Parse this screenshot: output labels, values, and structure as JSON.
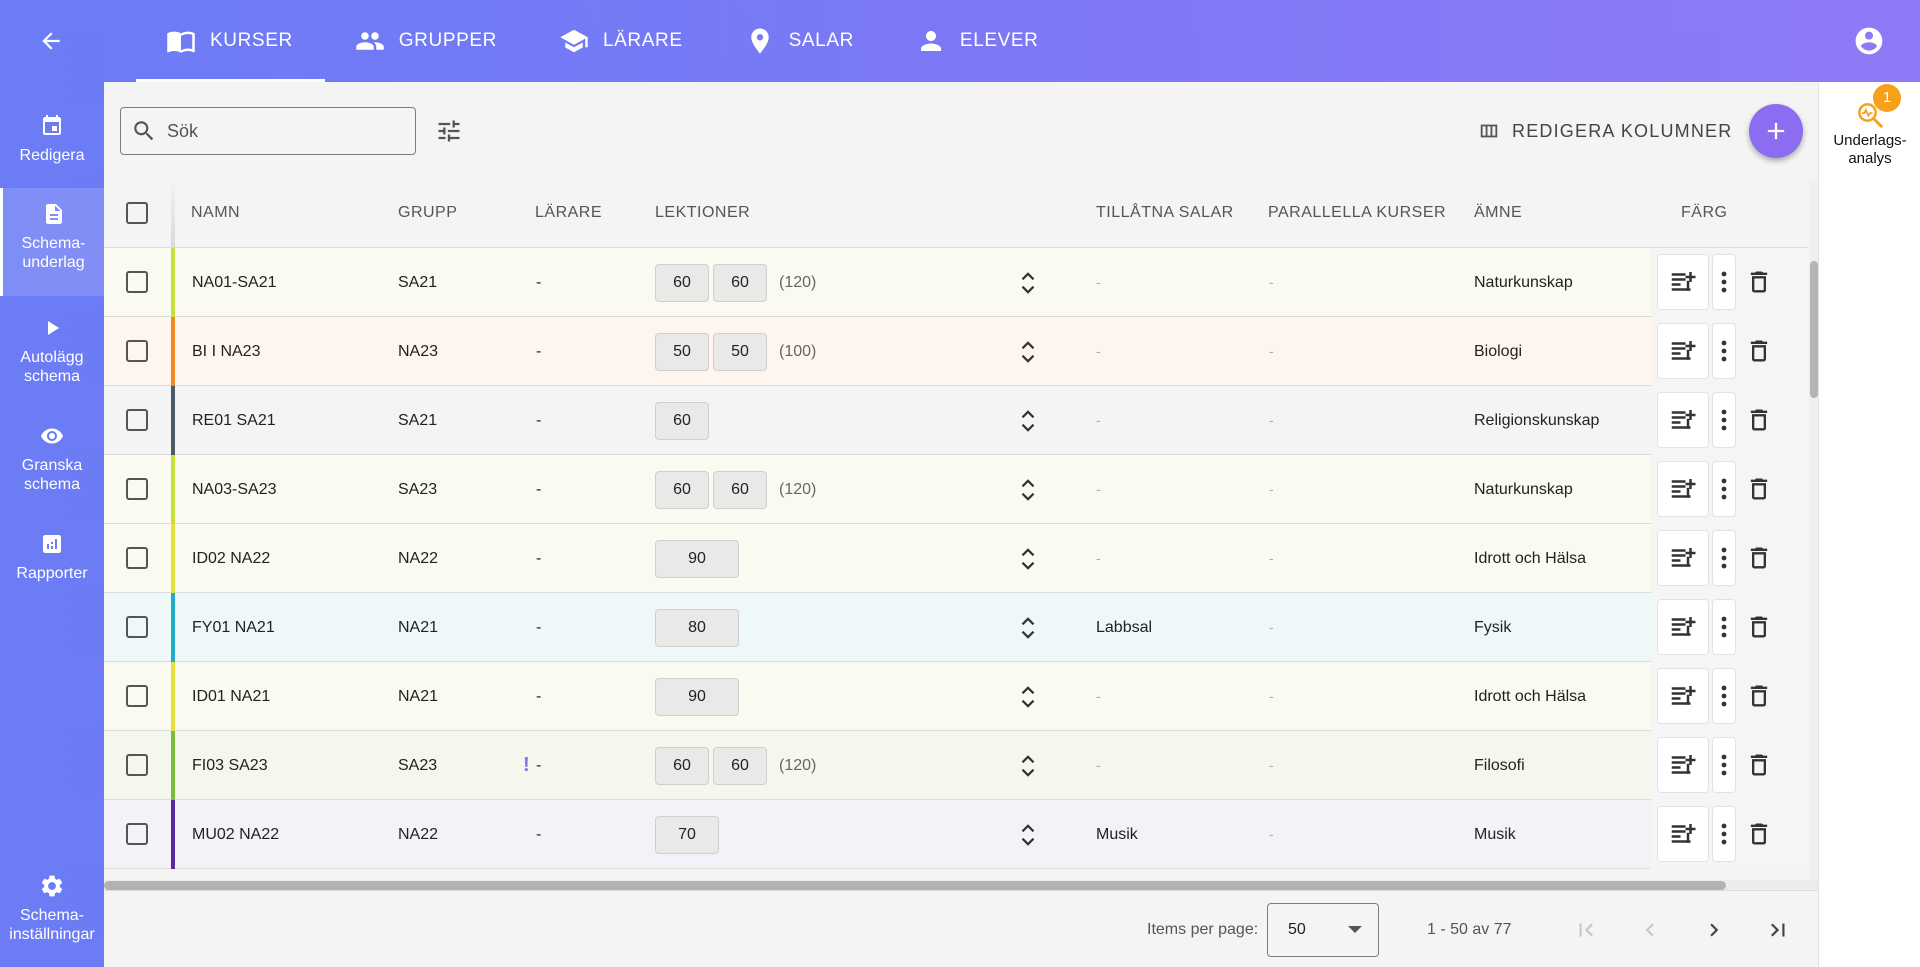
{
  "top_tabs": [
    {
      "label": "KURSER",
      "icon": "book-open-icon",
      "active": true
    },
    {
      "label": "GRUPPER",
      "icon": "people-icon",
      "active": false
    },
    {
      "label": "LÄRARE",
      "icon": "school-cap-icon",
      "active": false
    },
    {
      "label": "SALAR",
      "icon": "location-pin-icon",
      "active": false
    },
    {
      "label": "ELEVER",
      "icon": "person-icon",
      "active": false
    }
  ],
  "sidenav": [
    {
      "label": "Redigera",
      "icon": "calendar-icon",
      "active": false
    },
    {
      "label": "Schema-\nunderlag",
      "icon": "document-icon",
      "active": true
    },
    {
      "label": "Autolägg\nschema",
      "icon": "play-icon",
      "active": false
    },
    {
      "label": "Granska\nschema",
      "icon": "eye-icon",
      "active": false
    },
    {
      "label": "Rapporter",
      "icon": "report-icon",
      "active": false
    }
  ],
  "settings_label": "Schema-\ninställningar",
  "analysis": {
    "label": "Underlags-\nanalys",
    "badge": "1",
    "icon": "analysis-search-icon"
  },
  "search": {
    "placeholder": "Sök",
    "value": ""
  },
  "edit_columns_label": "REDIGERA KOLUMNER",
  "columns": {
    "name": "NAMN",
    "group": "GRUPP",
    "teachers": "LÄRARE",
    "lessons": "LEKTIONER",
    "rooms": "TILLÅTNA SALAR",
    "parallel": "PARALLELLA KURSER",
    "subject": "ÄMNE",
    "color": "FÄRG"
  },
  "rows": [
    {
      "name": "NA01-SA21",
      "group": "SA21",
      "teacher": "-",
      "warn": "",
      "lessons": [
        "60",
        "60"
      ],
      "total": "(120)",
      "rooms": "-",
      "parallel": "-",
      "subject": "Naturkunskap",
      "color": "#c6df3a",
      "bg": "#fbfaf0"
    },
    {
      "name": "BI I NA23",
      "group": "NA23",
      "teacher": "-",
      "warn": "",
      "lessons": [
        "50",
        "50"
      ],
      "total": "(100)",
      "rooms": "-",
      "parallel": "-",
      "subject": "Biologi",
      "color": "#f08a24",
      "bg": "#fdf5ee"
    },
    {
      "name": "RE01 SA21",
      "group": "SA21",
      "teacher": "-",
      "warn": "",
      "lessons": [
        "60"
      ],
      "total": "",
      "rooms": "-",
      "parallel": "-",
      "subject": "Religionskunskap",
      "color": "#4c5a66",
      "bg": "#f3f4f4"
    },
    {
      "name": "NA03-SA23",
      "group": "SA23",
      "teacher": "-",
      "warn": "",
      "lessons": [
        "60",
        "60"
      ],
      "total": "(120)",
      "rooms": "-",
      "parallel": "-",
      "subject": "Naturkunskap",
      "color": "#c6df3a",
      "bg": "#fbfaf0"
    },
    {
      "name": "ID02 NA22",
      "group": "NA22",
      "teacher": "-",
      "warn": "",
      "lessons": [
        "90"
      ],
      "total": "",
      "rooms": "-",
      "parallel": "-",
      "subject": "Idrott och Hälsa",
      "color": "#e6de3a",
      "bg": "#fbfaf0"
    },
    {
      "name": "FY01 NA21",
      "group": "NA21",
      "teacher": "-",
      "warn": "",
      "lessons": [
        "80"
      ],
      "total": "",
      "rooms": "Labbsal",
      "parallel": "-",
      "subject": "Fysik",
      "color": "#1eaecb",
      "bg": "#eff8f9"
    },
    {
      "name": "ID01 NA21",
      "group": "NA21",
      "teacher": "-",
      "warn": "",
      "lessons": [
        "90"
      ],
      "total": "",
      "rooms": "-",
      "parallel": "-",
      "subject": "Idrott och Hälsa",
      "color": "#e6de3a",
      "bg": "#fbfaf0"
    },
    {
      "name": "FI03 SA23",
      "group": "SA23",
      "teacher": "-",
      "warn": "!",
      "lessons": [
        "60",
        "60"
      ],
      "total": "(120)",
      "rooms": "-",
      "parallel": "-",
      "subject": "Filosofi",
      "color": "#7cba3e",
      "bg": "#f4f7ee"
    },
    {
      "name": "MU02 NA22",
      "group": "NA22",
      "teacher": "-",
      "warn": "",
      "lessons": [
        "70"
      ],
      "total": "",
      "rooms": "Musik",
      "parallel": "-",
      "subject": "Musik",
      "color": "#5a2a9c",
      "bg": "#f4f1f8"
    }
  ],
  "paginator": {
    "label": "Items per page:",
    "page_size": "50",
    "range": "1 - 50 av 77"
  }
}
